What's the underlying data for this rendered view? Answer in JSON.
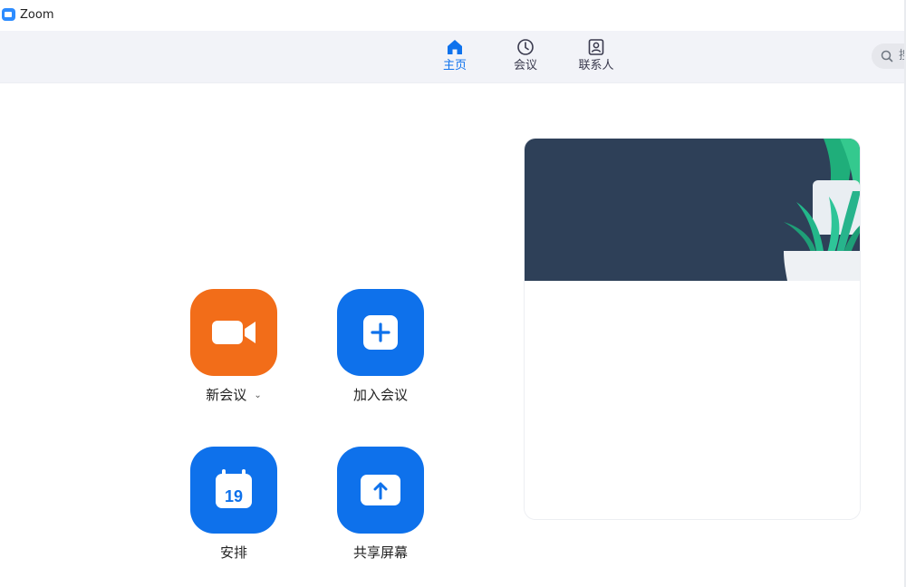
{
  "window": {
    "title": "Zoom"
  },
  "nav": {
    "tabs": [
      {
        "label": "主页",
        "icon": "home-icon",
        "active": true
      },
      {
        "label": "会议",
        "icon": "clock-icon",
        "active": false
      },
      {
        "label": "联系人",
        "icon": "contact-icon",
        "active": false
      }
    ],
    "search": {
      "label": "搜"
    }
  },
  "actions": {
    "new_meeting": {
      "label": "新会议",
      "icon": "video-camera-icon",
      "color": "#f26d19"
    },
    "join": {
      "label": "加入会议",
      "icon": "plus-icon",
      "color": "#0e71eb"
    },
    "schedule": {
      "label": "安排",
      "icon": "calendar-icon",
      "day": "19",
      "color": "#0e71eb"
    },
    "share_screen": {
      "label": "共享屏幕",
      "icon": "upload-arrow-icon",
      "color": "#0e71eb"
    }
  },
  "colors": {
    "accent": "#0e72ed",
    "banner": "#2e4058",
    "plant": "#2ebd8f"
  }
}
